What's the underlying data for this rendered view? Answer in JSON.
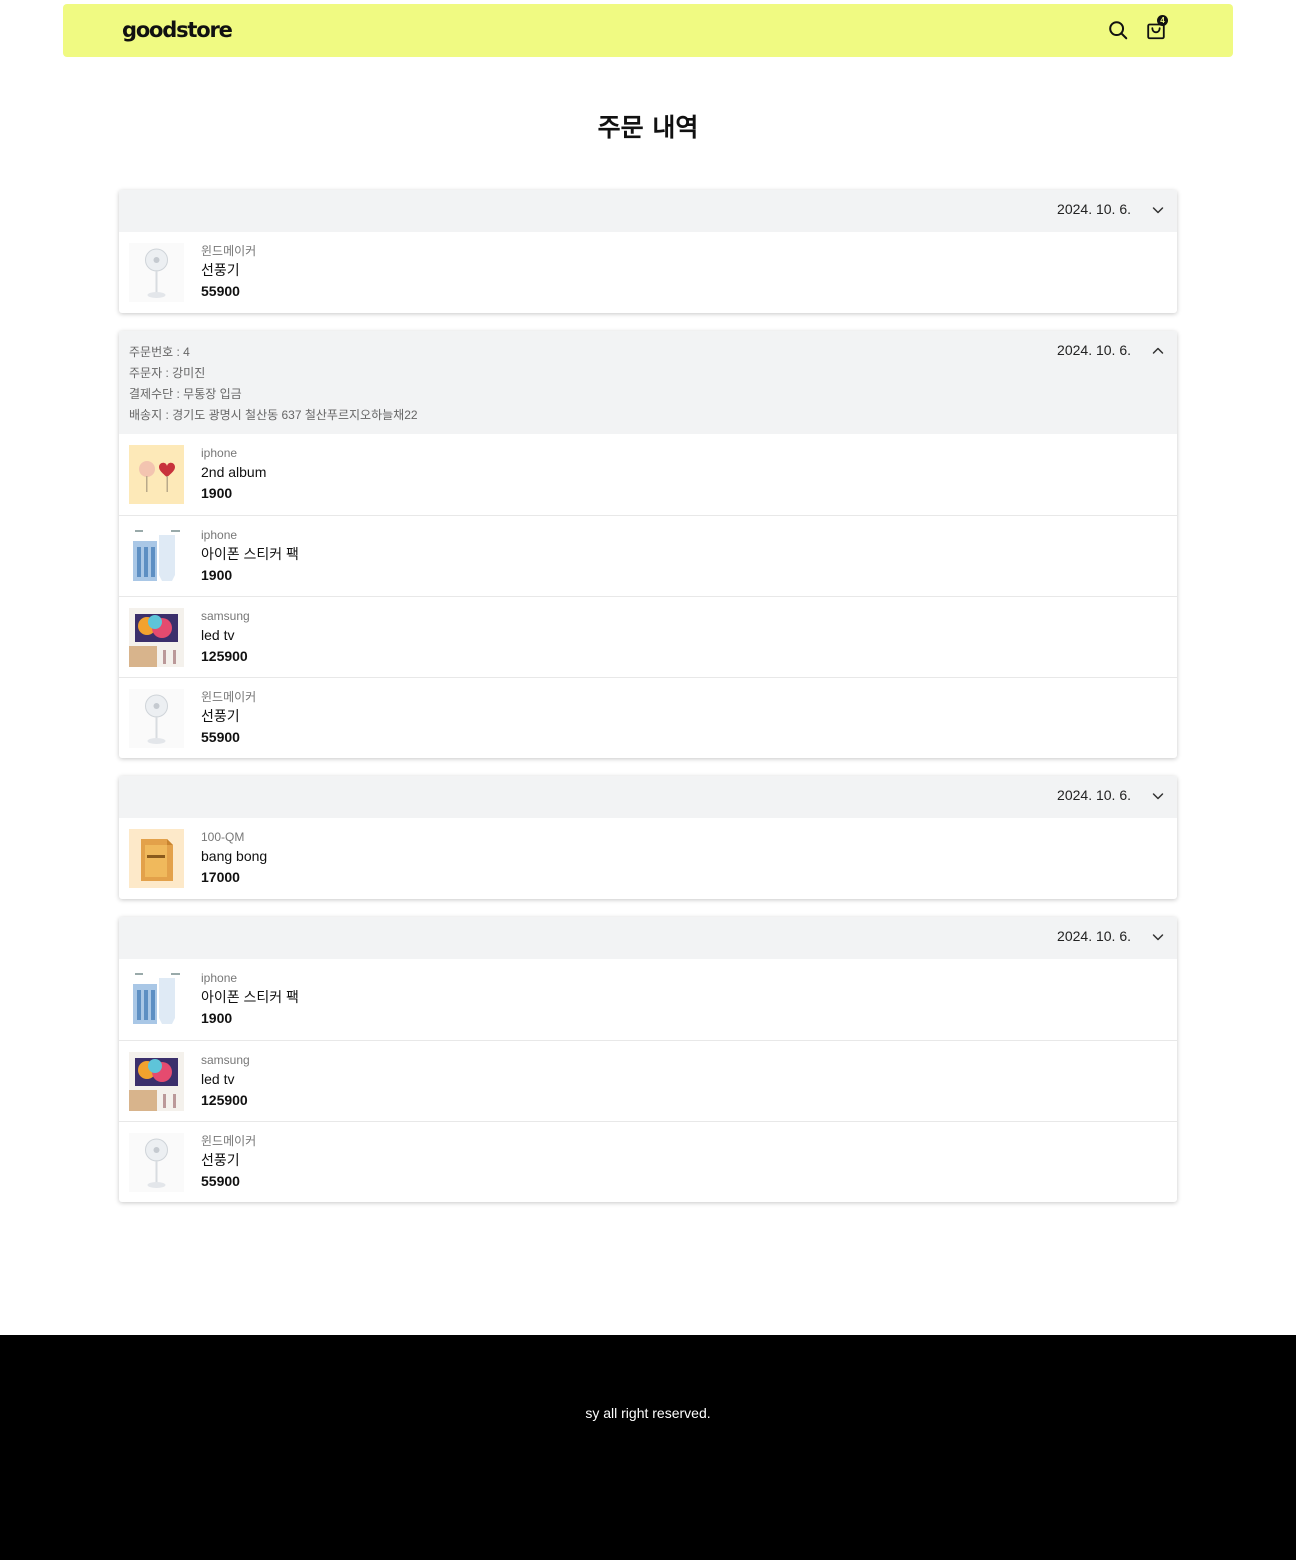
{
  "header": {
    "logo": "goodstore",
    "search_icon": "search-icon",
    "cart_icon": "shopping-bag-icon",
    "cart_count": "4",
    "background": "#f0fa82"
  },
  "page": {
    "title": "주문 내역"
  },
  "orders": [
    {
      "date": "2024. 10. 6.",
      "expanded": false,
      "items": [
        {
          "brand": "윈드메이커",
          "name": "선풍기",
          "price": "55900",
          "image": "fan"
        }
      ]
    },
    {
      "date": "2024. 10. 6.",
      "expanded": true,
      "info": {
        "order_no": "주문번호 : 4",
        "orderer": "주문자 : 강미진",
        "payment": "결제수단 : 무통장 입금",
        "address": "배송지 : 경기도 광명시 철산동 637 철산푸르지오하늘채22"
      },
      "items": [
        {
          "brand": "iphone",
          "name": "2nd album",
          "price": "1900",
          "image": "album"
        },
        {
          "brand": "iphone",
          "name": "아이폰 스티커 팩",
          "price": "1900",
          "image": "sticker"
        },
        {
          "brand": "samsung",
          "name": "led tv",
          "price": "125900",
          "image": "tv"
        },
        {
          "brand": "윈드메이커",
          "name": "선풍기",
          "price": "55900",
          "image": "fan"
        }
      ]
    },
    {
      "date": "2024. 10. 6.",
      "expanded": false,
      "items": [
        {
          "brand": "100-QM",
          "name": "bang bong",
          "price": "17000",
          "image": "box"
        }
      ]
    },
    {
      "date": "2024. 10. 6.",
      "expanded": false,
      "items": [
        {
          "brand": "iphone",
          "name": "아이폰 스티커 팩",
          "price": "1900",
          "image": "sticker"
        },
        {
          "brand": "samsung",
          "name": "led tv",
          "price": "125900",
          "image": "tv"
        },
        {
          "brand": "윈드메이커",
          "name": "선풍기",
          "price": "55900",
          "image": "fan"
        }
      ]
    }
  ],
  "footer": {
    "text": "sy all right reserved."
  }
}
